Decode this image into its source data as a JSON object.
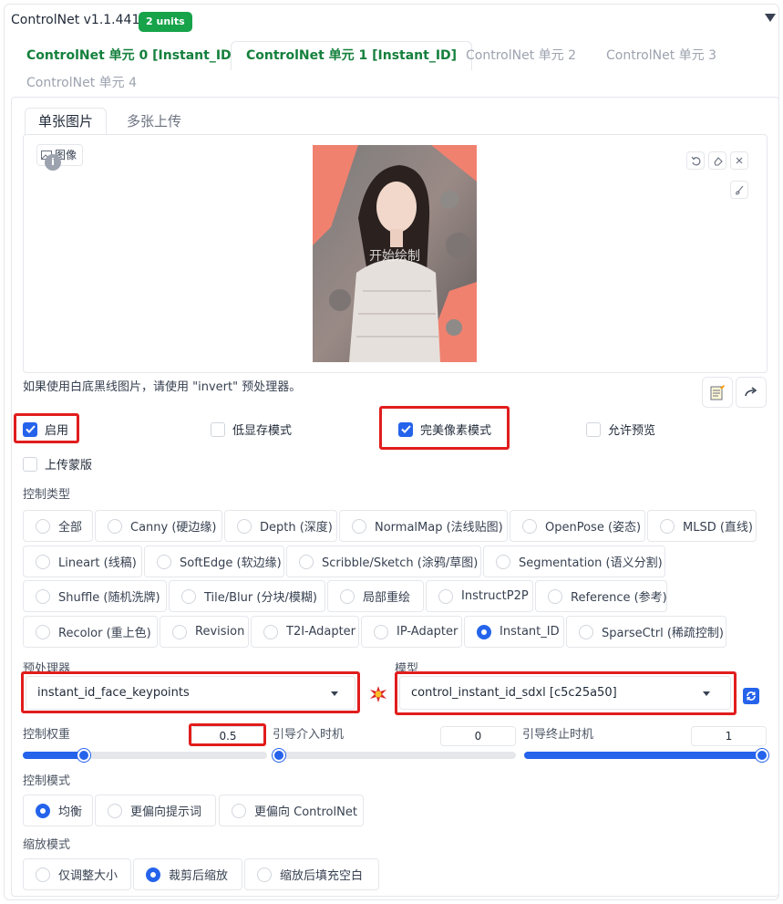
{
  "header": {
    "title": "ControlNet v1.1.441",
    "badge": "2 units"
  },
  "unit_tabs": [
    "ControlNet 单元 0 [Instant_ID]",
    "ControlNet 单元 1 [Instant_ID]",
    "ControlNet 单元 2",
    "ControlNet 单元 3",
    "ControlNet 单元 4"
  ],
  "input_tabs": [
    "单张图片",
    "多张上传"
  ],
  "image": {
    "label": "图像",
    "overlay": "开始绘制"
  },
  "hint": "如果使用白底黑线图片，请使用 \"invert\" 预处理器。",
  "checkboxes": {
    "enable": "启用",
    "low_vram": "低显存模式",
    "pixel_perfect": "完美像素模式",
    "allow_preview": "允许预览",
    "upload_mask": "上传蒙版"
  },
  "control_type": {
    "label": "控制类型",
    "options": [
      "全部",
      "Canny (硬边缘)",
      "Depth (深度)",
      "NormalMap (法线贴图)",
      "OpenPose (姿态)",
      "MLSD (直线)",
      "Lineart (线稿)",
      "SoftEdge (软边缘)",
      "Scribble/Sketch (涂鸦/草图)",
      "Segmentation (语义分割)",
      "Shuffle (随机洗牌)",
      "Tile/Blur (分块/模糊)",
      "局部重绘",
      "InstructP2P",
      "Reference (参考)",
      "Recolor (重上色)",
      "Revision",
      "T2I-Adapter",
      "IP-Adapter",
      "Instant_ID",
      "SparseCtrl (稀疏控制)"
    ],
    "selected": "Instant_ID"
  },
  "preprocessor": {
    "label": "预处理器",
    "value": "instant_id_face_keypoints"
  },
  "model": {
    "label": "模型",
    "value": "control_instant_id_sdxl [c5c25a50]"
  },
  "weight": {
    "label": "控制权重",
    "value": "0.5",
    "fraction": 0.25
  },
  "start": {
    "label": "引导介入时机",
    "value": "0",
    "fraction": 0.0
  },
  "end": {
    "label": "引导终止时机",
    "value": "1",
    "fraction": 1.0
  },
  "control_mode": {
    "label": "控制模式",
    "options": [
      "均衡",
      "更偏向提示词",
      "更偏向 ControlNet"
    ],
    "selected": "均衡"
  },
  "resize_mode": {
    "label": "缩放模式",
    "options": [
      "仅调整大小",
      "裁剪后缩放",
      "缩放后填充空白"
    ],
    "selected": "裁剪后缩放"
  },
  "colors": {
    "accent": "#2563eb",
    "badge": "#16a34a",
    "tab_active": "#15803d",
    "highlight": "#e11d1d"
  }
}
